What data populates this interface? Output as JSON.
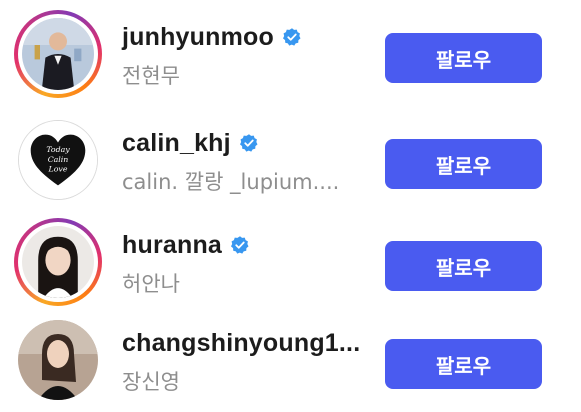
{
  "colors": {
    "follow_button_bg": "#4a5bf0",
    "verified_badge": "#3897f0",
    "username_text": "#1c1c1c",
    "subtitle_text": "#8e8e8e"
  },
  "suggestions": [
    {
      "username": "junhyunmoo",
      "subtitle": "전현무",
      "verified": true,
      "story_ring": true,
      "follow_label": "팔로우"
    },
    {
      "username": "calin_khj",
      "subtitle": "calin. 깔랑 _lupium....",
      "verified": true,
      "story_ring": false,
      "avatar_logo_text": "Today Calin Love",
      "follow_label": "팔로우"
    },
    {
      "username": "huranna",
      "subtitle": "허안나",
      "verified": true,
      "story_ring": true,
      "follow_label": "팔로우"
    },
    {
      "username": "changshinyoung1...",
      "subtitle": "장신영",
      "verified": false,
      "story_ring": false,
      "follow_label": "팔로우"
    }
  ]
}
